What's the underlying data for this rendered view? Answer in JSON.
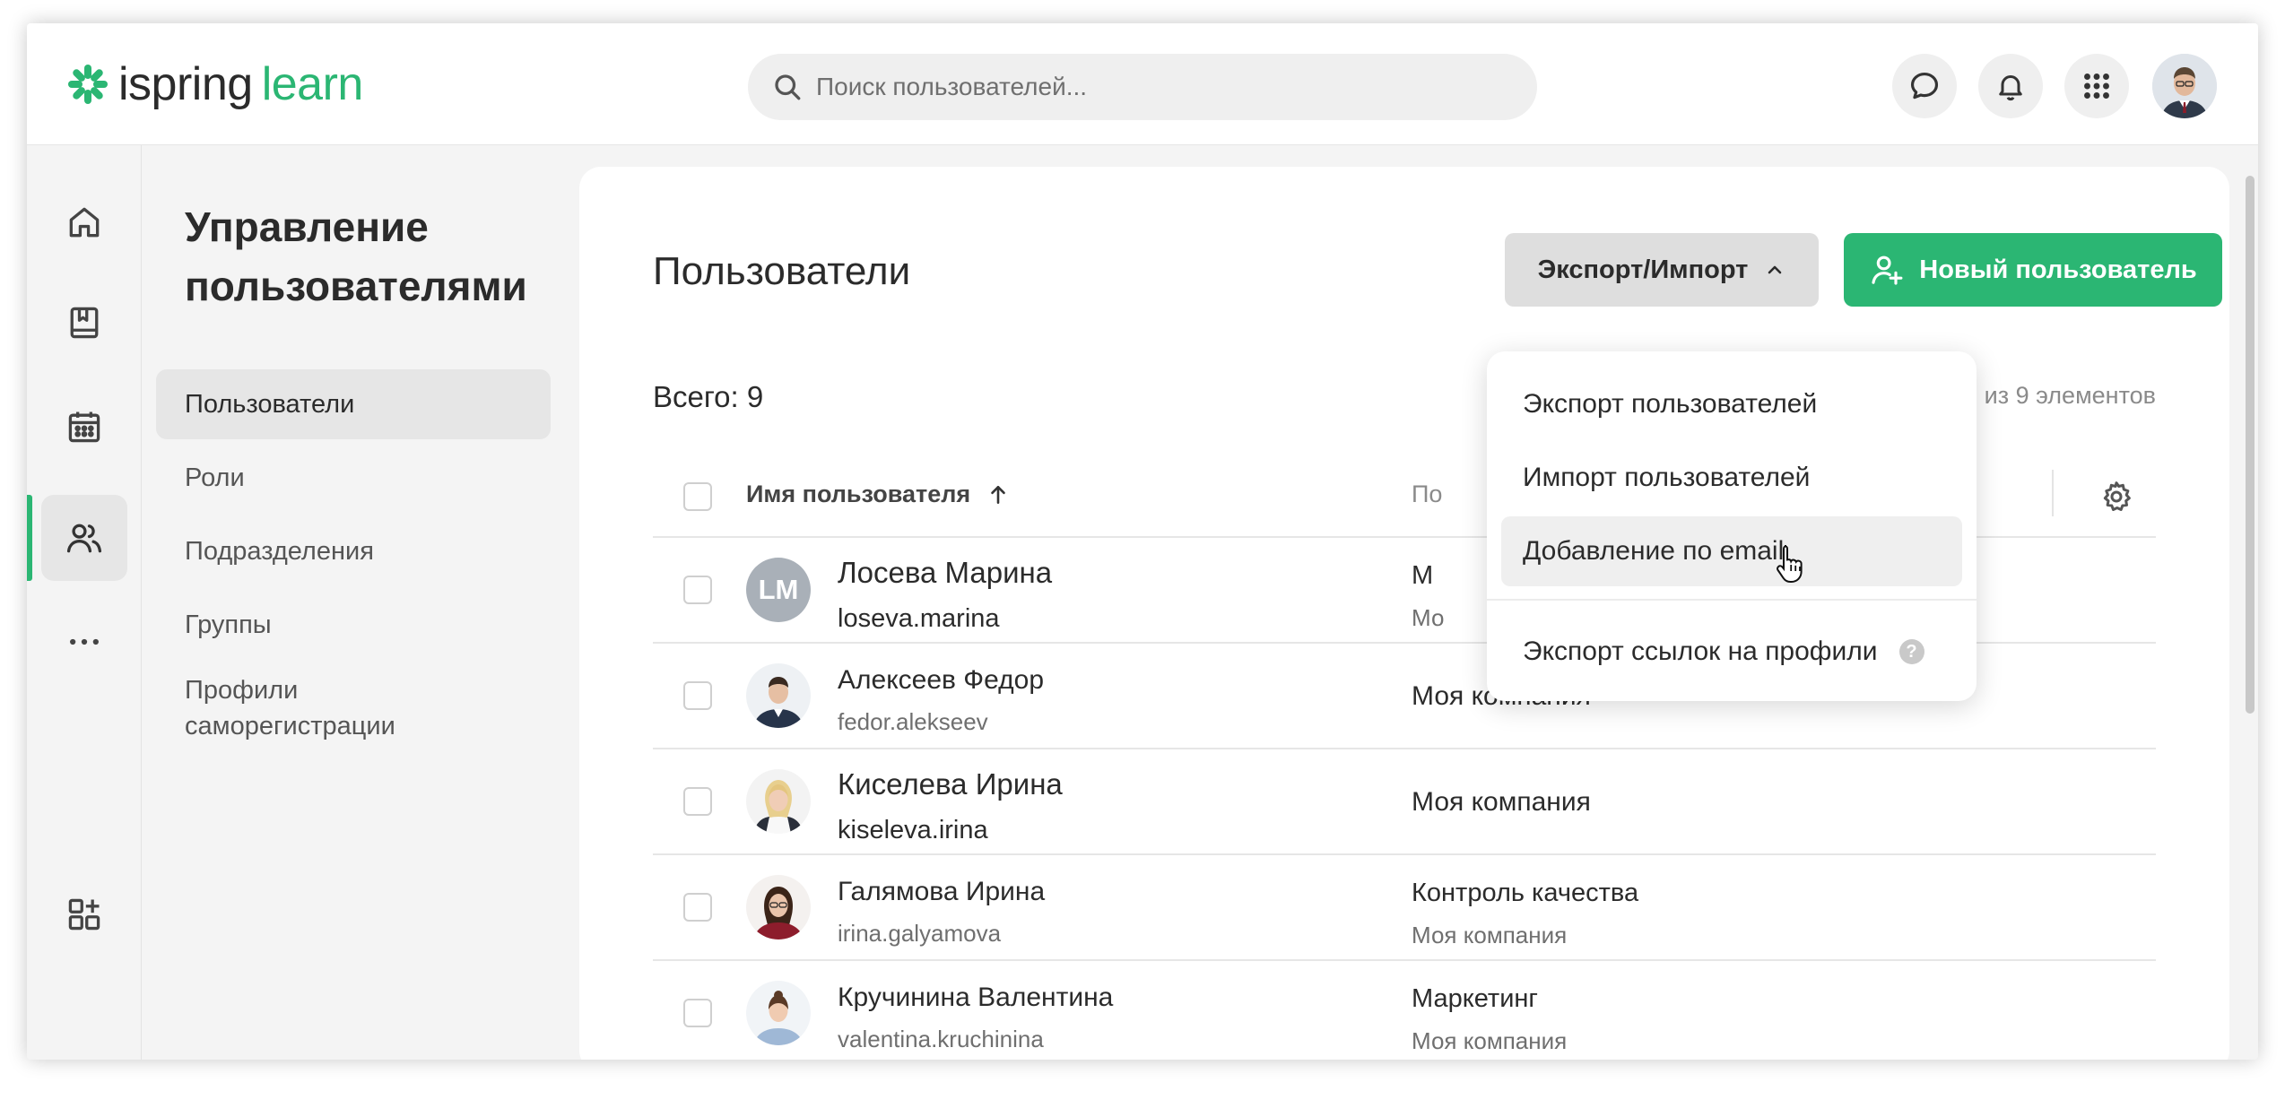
{
  "app": {
    "logo_primary": "ispring",
    "logo_secondary": "learn",
    "brand_color": "#2bb673"
  },
  "search": {
    "placeholder": "Поиск пользователей..."
  },
  "topbar_icons": [
    "chat-icon",
    "bell-icon",
    "apps-grid-icon",
    "user-avatar"
  ],
  "rail": {
    "items": [
      "home-icon",
      "book-icon",
      "calendar-icon",
      "users-icon",
      "more-icon",
      "add-app-icon"
    ],
    "active": "users-icon"
  },
  "sidebar": {
    "title": "Управление пользователями",
    "items": [
      {
        "label": "Пользователи",
        "active": true
      },
      {
        "label": "Роли"
      },
      {
        "label": "Подразделения"
      },
      {
        "label": "Группы"
      },
      {
        "label": "Профили саморегистрации"
      }
    ]
  },
  "main": {
    "title": "Пользователи",
    "export_label": "Экспорт/Импорт",
    "new_user_label": "Новый пользователь",
    "total_label": "Всего: 9",
    "range_label": "1–9 из 9 элементов",
    "columns": {
      "name": "Имя пользователя",
      "dept": "По"
    }
  },
  "dropdown": {
    "items": [
      {
        "label": "Экспорт пользователей"
      },
      {
        "label": "Импорт пользователей"
      },
      {
        "label": "Добавление по email",
        "hover": true
      },
      {
        "label": "Экспорт ссылок на профили",
        "help": "?"
      }
    ]
  },
  "rows": [
    {
      "name": "Лосева Марина",
      "login": "loseva.marina",
      "initials": "LM",
      "dept": "М",
      "company": "Мо"
    },
    {
      "name": "Алексеев Федор",
      "login": "fedor.alekseev",
      "company": "Моя компания"
    },
    {
      "name": "Киселева Ирина",
      "login": "kiseleva.irina",
      "company": "Моя компания"
    },
    {
      "name": "Галямова Ирина",
      "login": "irina.galyamova",
      "dept": "Контроль качества",
      "company": "Моя компания"
    },
    {
      "name": "Кручинина Валентина",
      "login": "valentina.kruchinina",
      "dept": "Маркетинг",
      "company": "Моя компания"
    }
  ]
}
